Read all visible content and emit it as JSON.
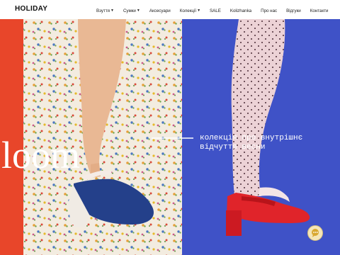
{
  "header": {
    "logo": "HOLIDAY",
    "nav": [
      {
        "label": "Взуття",
        "dropdown": true
      },
      {
        "label": "Сумки",
        "dropdown": true
      },
      {
        "label": "Аксесуари",
        "dropdown": false
      },
      {
        "label": "Колекції",
        "dropdown": true
      },
      {
        "label": "SALE",
        "dropdown": false
      },
      {
        "label": "Kolizhanka",
        "dropdown": false
      },
      {
        "label": "Про нас",
        "dropdown": false
      },
      {
        "label": "Відгуки",
        "dropdown": false
      },
      {
        "label": "Контакти",
        "dropdown": false
      }
    ]
  },
  "hero": {
    "big_word": "loom",
    "tagline_line1": "колекція про внутрішнє",
    "tagline_line2": "відчуття весни"
  },
  "colors": {
    "left_bg": "#f3ece0",
    "red_strip": "#e8462a",
    "right_bg": "#3f52c7",
    "navy_shoe": "#24408a",
    "red_shoe": "#e0242a",
    "tights": "#ecd2d6",
    "skin": "#e9b894"
  },
  "icons": {
    "chevron": "chevron-down-icon",
    "chat": "chat-bubble-icon"
  }
}
